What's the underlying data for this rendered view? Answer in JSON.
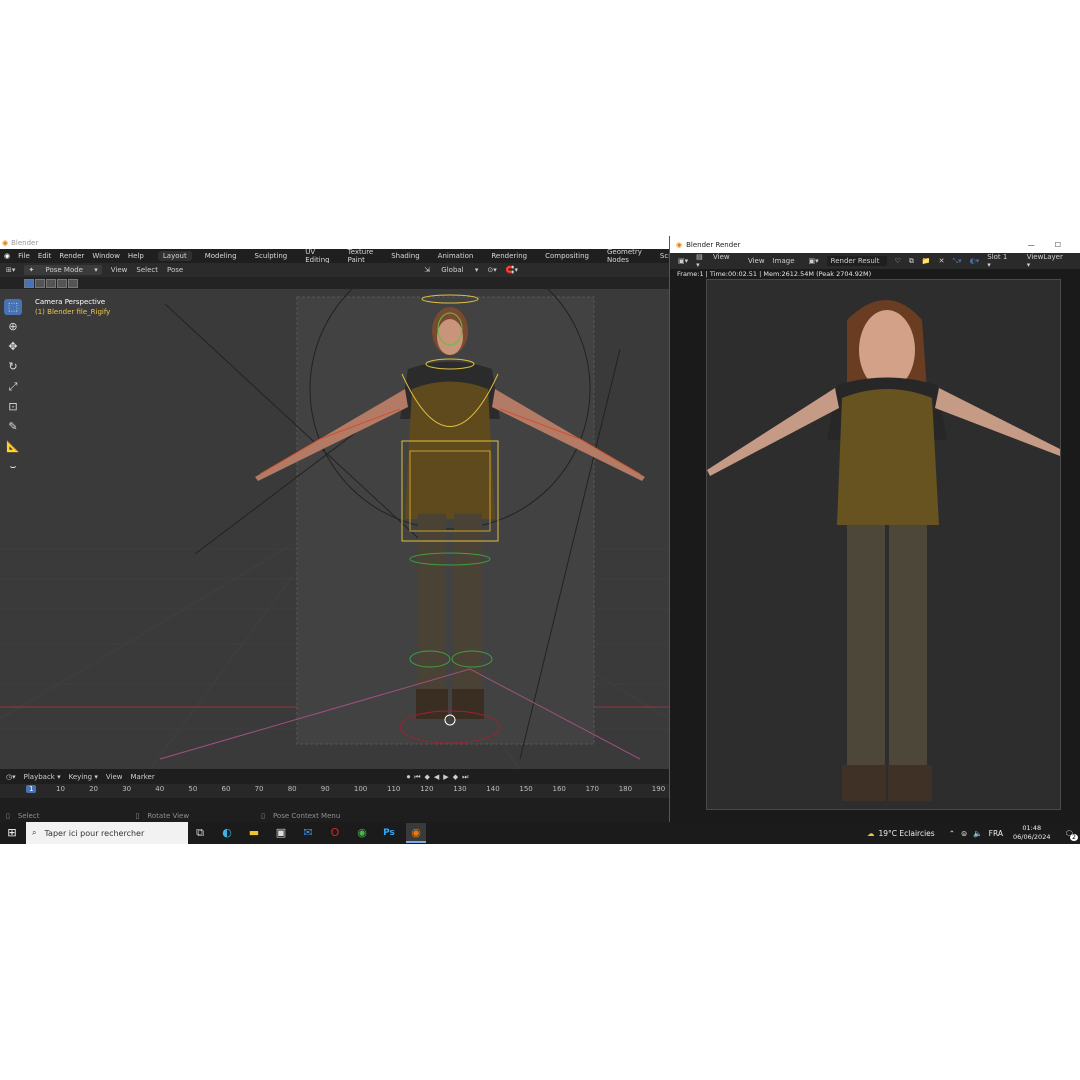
{
  "blender": {
    "title": "Blender",
    "menu": [
      "File",
      "Edit",
      "Render",
      "Window",
      "Help"
    ],
    "workspaces": [
      "Layout",
      "Modeling",
      "Sculpting",
      "UV Editing",
      "Texture Paint",
      "Shading",
      "Animation",
      "Rendering",
      "Compositing",
      "Geometry Nodes",
      "Scripting",
      "+"
    ],
    "active_workspace": "Layout",
    "header": {
      "mode": "Pose Mode",
      "view": "View",
      "select": "Select",
      "pose": "Pose",
      "transform_orientation": "Global"
    },
    "viewport": {
      "camera_label": "Camera Perspective",
      "object_label": "(1) Blender file_Rigify"
    },
    "timeline": {
      "playback": "Playback",
      "keying": "Keying",
      "view": "View",
      "marker": "Marker",
      "current_frame": "1",
      "ruler_ticks": [
        "10",
        "20",
        "30",
        "40",
        "50",
        "60",
        "70",
        "80",
        "90",
        "100",
        "110",
        "120",
        "130",
        "140",
        "150",
        "160",
        "170",
        "180",
        "190"
      ]
    },
    "status": {
      "select": "Select",
      "rotate": "Rotate View",
      "context": "Pose Context Menu"
    },
    "colors": {
      "accent": "#4772b3",
      "object_label": "#f0c64b"
    }
  },
  "render_window": {
    "title": "Blender Render",
    "header": {
      "view": "View",
      "view2": "View",
      "image": "Image",
      "image_name": "Render Result",
      "slot": "Slot 1",
      "layer": "ViewLayer"
    },
    "frame_info": "Frame:1 | Time:00:02.51 | Mem:2612.54M (Peak 2704.92M)"
  },
  "taskbar": {
    "search_placeholder": "Taper ici pour rechercher",
    "apps": [
      "task-view-icon",
      "edge-icon",
      "file-explorer-icon",
      "store-icon",
      "mail-icon",
      "opera-icon",
      "chrome-icon",
      "photoshop-icon",
      "blender-icon"
    ],
    "weather": "19°C  Eclaircies",
    "language": "FRA",
    "time": "01:48",
    "date": "06/06/2024",
    "notifications": "2"
  }
}
